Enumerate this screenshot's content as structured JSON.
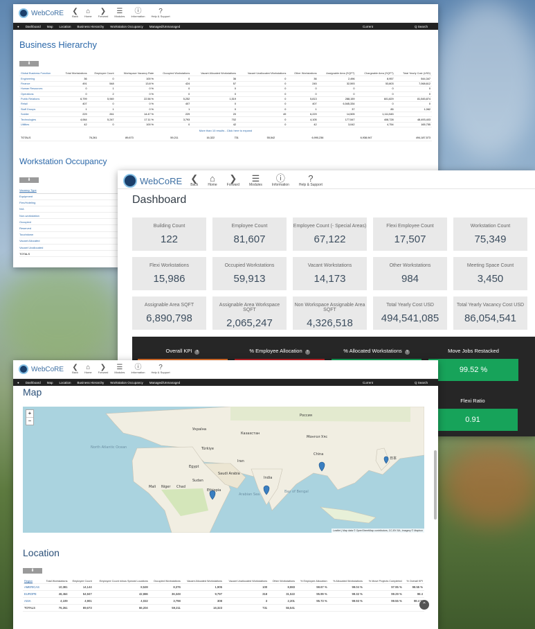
{
  "colors": {
    "accent": "#2a67a8",
    "navbar": "#222222",
    "kpi_green": "#17a35a",
    "kpi_orange": "#e0702a",
    "kpi_red": "#c0262b",
    "map_water": "#aad3df",
    "map_land": "#f1eee2"
  },
  "app": {
    "brand": "WebCoRE"
  },
  "toolbar": {
    "back": "Back",
    "home": "Home",
    "forward": "Forward",
    "modules": "Modules",
    "information": "Information",
    "help": "Help & Support"
  },
  "nav": {
    "items": [
      "Dashboard",
      "Map",
      "Location",
      "Business Hierarchy",
      "Workstation Occupancy",
      "Managed/Unmanaged"
    ],
    "current": "Current",
    "search": "Q Search"
  },
  "bh": {
    "title": "Business Hierarchy",
    "columns": [
      "Global Business Function",
      "Total Workstations",
      "Employee Count",
      "Workspace Vacancy Rate",
      "Occupied Workstations",
      "Vacant Allocated Workstations",
      "Vacant Unallocated Workstations",
      "Other Workstations",
      "Assignable Area (SQFT)",
      "Chargeable Area (SQFT)",
      "Total Yearly Cost (USD)"
    ],
    "rows": [
      [
        "Engineering",
        "36",
        "0",
        "100 %",
        "0",
        "36",
        "0",
        "36",
        "2,496",
        "8,957",
        "544,347"
      ],
      [
        "Finance",
        "491",
        "548",
        "13.8 %",
        "424",
        "57",
        "0",
        "245",
        "32,593",
        "53,803",
        "7,068,612"
      ],
      [
        "Human Resources",
        "0",
        "1",
        "0 %",
        "0",
        "0",
        "0",
        "0",
        "0",
        "0",
        "0"
      ],
      [
        "Operations",
        "0",
        "2",
        "0 %",
        "0",
        "0",
        "0",
        "0",
        "0",
        "0",
        "0"
      ],
      [
        "Public Relations",
        "6,799",
        "5,949",
        "22.56 %",
        "5,252",
        "1,519",
        "0",
        "5,813",
        "288,159",
        "601,829",
        "81,545,874"
      ],
      [
        "Retail",
        "407",
        "0",
        "0 %",
        "407",
        "0",
        "0",
        "407",
        "6,545,334",
        "0",
        "0"
      ],
      [
        "Staff Groups",
        "1",
        "1",
        "0 %",
        "1",
        "0",
        "0",
        "1",
        "37",
        "85",
        "1,062"
      ],
      [
        "Soldier",
        "229",
        "261",
        "14.47 %",
        "229",
        "20",
        "49",
        "6,229",
        "14,505",
        "1,111,545",
        ""
      ],
      [
        "Technologies",
        "4,064",
        "5,247",
        "17.11 %",
        "3,793",
        "702",
        "0",
        "4,105",
        "177,547",
        "408,728",
        "48,493,403"
      ],
      [
        "Utilities",
        "42",
        "0",
        "100 %",
        "0",
        "42",
        "0",
        "42",
        "3,042",
        "4,754",
        "165,755"
      ]
    ],
    "more": "More than 10 results - Click here to expand",
    "totals": [
      "TOTALS",
      "76,261",
      "89,673",
      "",
      "59,211",
      "16,322",
      "731",
      "55,542",
      "6,990,236",
      "6,938,947",
      "494,187,573"
    ]
  },
  "wo": {
    "title": "Workstation Occupancy",
    "header": "Vacancy Type",
    "items": [
      "Equipment",
      "Flex/Hoteling",
      "N/A",
      "Non-workstation",
      "Occupied",
      "Reserved",
      "Touchdown",
      "Vacant Allocated",
      "Vacant Unallocated",
      "TOTALS"
    ]
  },
  "dash": {
    "title": "Dashboard",
    "cards": [
      {
        "label": "Building Count",
        "value": "122"
      },
      {
        "label": "Employee Count",
        "value": "81,607"
      },
      {
        "label": "Employee Count (- Special Areas)",
        "value": "67,122"
      },
      {
        "label": "Flexi Employee Count",
        "value": "17,507"
      },
      {
        "label": "Workstation Count",
        "value": "75,349"
      },
      {
        "label": "Flexi Workstations",
        "value": "15,986"
      },
      {
        "label": "Occupied Workstations",
        "value": "59,913"
      },
      {
        "label": "Vacant Workstations",
        "value": "14,173"
      },
      {
        "label": "Other Workstations",
        "value": "984"
      },
      {
        "label": "Meeting Space Count",
        "value": "3,450"
      },
      {
        "label": "Assignable Area SQFT",
        "value": "6,890,798"
      },
      {
        "label": "Assignable Area Workspace SQFT",
        "value": "2,065,247"
      },
      {
        "label": "Non Workspace Assignable Area SQFT",
        "value": "4,326,518"
      },
      {
        "label": "Total Yearly Cost USD",
        "value": "494,541,085"
      },
      {
        "label": "Total Yearly Vacancy Cost USD",
        "value": "86,054,541"
      }
    ],
    "kpis": [
      {
        "label": "Overall KPI",
        "color": "#e0702a"
      },
      {
        "label": "% Employee Allocation",
        "color": "#c0262b"
      },
      {
        "label": "% Allocated Workstations",
        "color": "#17a35a"
      },
      {
        "label": "Move Jobs Restacked",
        "value": "99.52 %",
        "color": "#17a35a"
      }
    ],
    "flexi": {
      "label": "Flexi Ratio",
      "value": "0.91"
    }
  },
  "map": {
    "title": "Map",
    "zoom_in": "+",
    "zoom_out": "−",
    "labels": {
      "north_atlantic": "North Atlantic Ocean",
      "arabian_sea": "Arabian Sea",
      "bay_of_bengal": "Bay of Bengal",
      "mali": "Mali",
      "niger": "Niger",
      "chad": "Chad",
      "sudan": "Sudan",
      "ethiopia": "Ethiopia",
      "india": "India",
      "china": "China",
      "mongolia": "Монгол Улс",
      "kazakhstan": "Казахстан",
      "turkey": "Türkiye",
      "iran": "Iran",
      "egypt": "Egypt",
      "saudi": "Saudi Arabia",
      "ukraine": "Україна",
      "russia": "Россия",
      "japan": "日本"
    },
    "attribution": "Leaflet | Map data © OpenStreetMap contributors, CC-BY-SA, Imagery © Mapbox"
  },
  "loc": {
    "title": "Location",
    "columns": [
      "Region",
      "Total Workstations",
      "Employee Count",
      "Employee Count minus Special Locations",
      "Occupied Workstations",
      "Vacant Allocated Workstations",
      "Vacant Unallocated Workstations",
      "Other Workstations",
      "% Employee Allocation",
      "% Allocated Workstations",
      "% Move Projects Completed",
      "% Overall KPI"
    ],
    "rows": [
      [
        "AMERICAS",
        "10,381",
        "14,144",
        "8,528",
        "8,376",
        "1,905",
        "100",
        "8,883",
        "98.67 %",
        "99.04 %",
        "97.95 %",
        "98.55 %"
      ],
      [
        "EUROPE",
        "46,464",
        "54,947",
        "42,886",
        "36,348",
        "9,797",
        "318",
        "31,522",
        "95.99 %",
        "99.32 %",
        "99.29 %",
        "98.4"
      ],
      [
        "ASIA",
        "4,109",
        "4,901",
        "4,022",
        "3,798",
        "308",
        "3",
        "2,201",
        "95.73 %",
        "99.93 %",
        "99.55 %",
        "98.4 %"
      ]
    ],
    "totals": [
      "TOTALS",
      "76,261",
      "89,673",
      "66,204",
      "59,211",
      "16,323",
      "731",
      "55,541",
      "",
      "",
      "",
      ""
    ]
  }
}
